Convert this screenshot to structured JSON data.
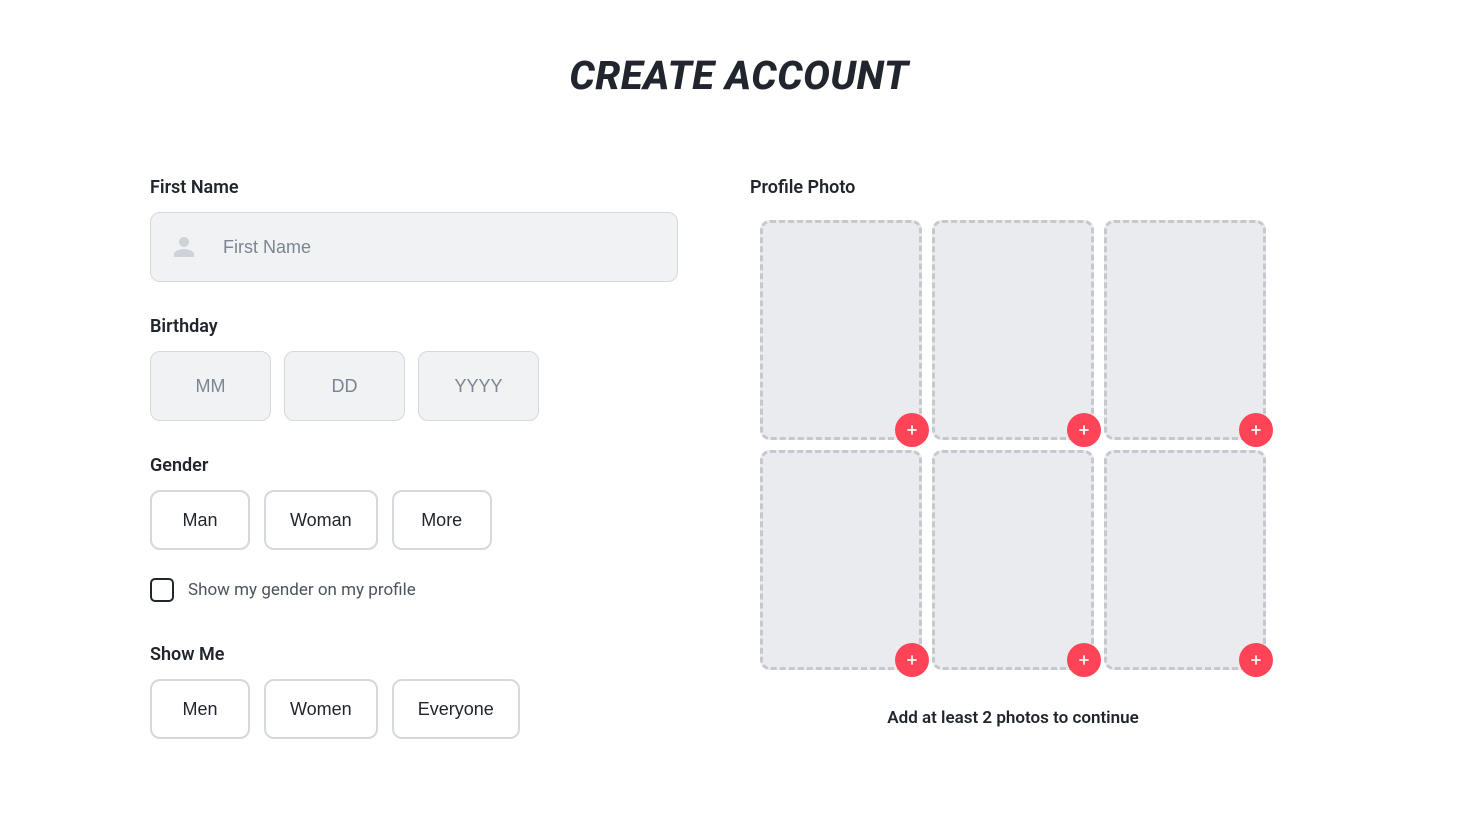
{
  "title": "CREATE ACCOUNT",
  "firstName": {
    "label": "First Name",
    "placeholder": "First Name",
    "value": ""
  },
  "birthday": {
    "label": "Birthday",
    "mm": {
      "placeholder": "MM",
      "value": ""
    },
    "dd": {
      "placeholder": "DD",
      "value": ""
    },
    "yyyy": {
      "placeholder": "YYYY",
      "value": ""
    }
  },
  "gender": {
    "label": "Gender",
    "options": [
      "Man",
      "Woman",
      "More"
    ],
    "showOnProfile": {
      "checked": false,
      "label": "Show my gender on my profile"
    }
  },
  "showMe": {
    "label": "Show Me",
    "options": [
      "Men",
      "Women",
      "Everyone"
    ]
  },
  "profilePhoto": {
    "label": "Profile Photo",
    "slots": 6,
    "hint": "Add at least 2 photos to continue"
  },
  "colors": {
    "accent": "#ff4458",
    "border": "#d5d9de",
    "inputBg": "#f0f2f4",
    "slotBg": "#e9ebee",
    "text": "#21262e"
  }
}
